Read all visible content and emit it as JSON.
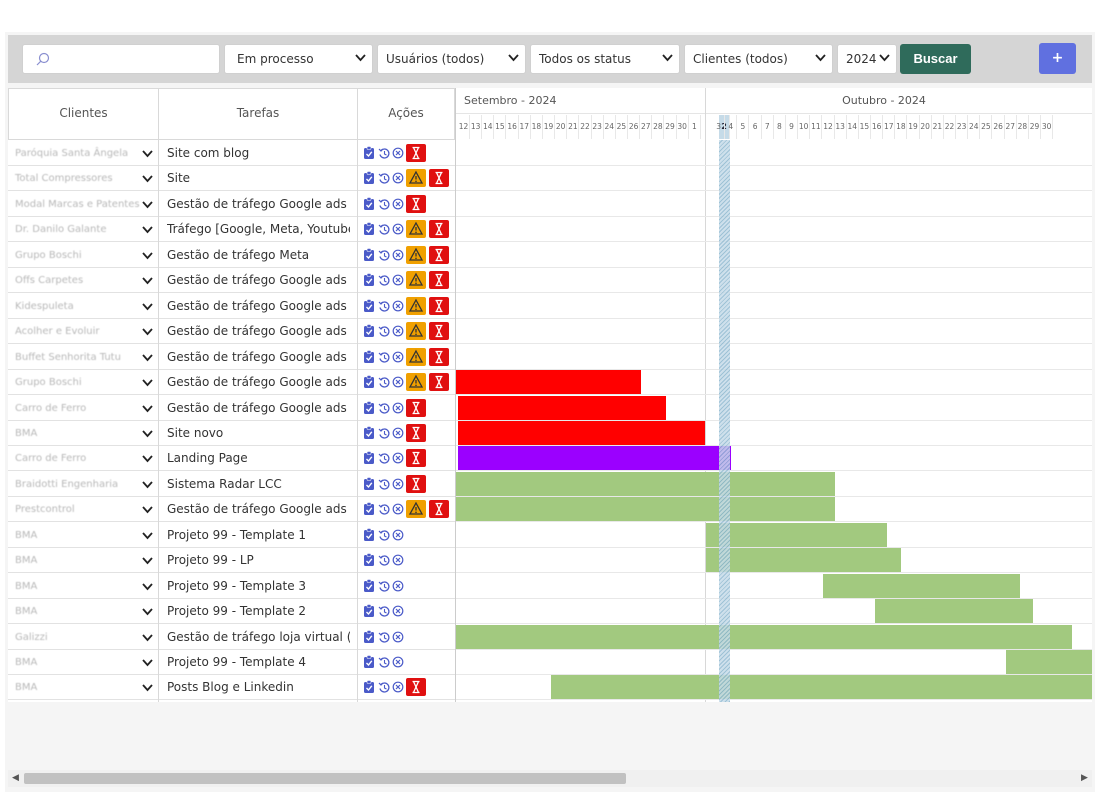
{
  "toolbar": {
    "search_placeholder": "",
    "filters": [
      "Em processo",
      "Usuários (todos)",
      "Todos os status",
      "Clientes (todos)",
      "2024"
    ],
    "buscar_label": "Buscar",
    "add_label": "+"
  },
  "columns": {
    "clientes": "Clientes",
    "tarefas": "Tarefas",
    "acoes": "Ações"
  },
  "gantt": {
    "month_sep": "Setembro - 2024",
    "month_oct": "Outubro - 2024",
    "days_sep": [
      "12",
      "13",
      "14",
      "15",
      "16",
      "17",
      "18",
      "19",
      "20",
      "21",
      "22",
      "23",
      "24",
      "25",
      "26",
      "27",
      "28",
      "29",
      "30"
    ],
    "days_oct": [
      "1",
      "2",
      "3",
      "4",
      "5",
      "6",
      "7",
      "8",
      "9",
      "10",
      "11",
      "12",
      "13",
      "14",
      "15",
      "16",
      "17",
      "18",
      "19",
      "20",
      "21",
      "22",
      "23",
      "24",
      "25",
      "26",
      "27",
      "28",
      "29",
      "30"
    ],
    "today_day": "2"
  },
  "colors": {
    "red": "#ff0000",
    "purple": "#9b00ff",
    "green": "#a2c97f",
    "warn": "#f0a000",
    "hourglass": "#e01010",
    "accent": "#2f6b5b"
  },
  "rows": [
    {
      "client": "Paróquia Santa Ângela",
      "task": "Site com blog",
      "warn": false,
      "hour": true,
      "bar": null
    },
    {
      "client": "Total Compressores",
      "task": "Site",
      "warn": true,
      "hour": true,
      "bar": null
    },
    {
      "client": "Modal Marcas e Patentes",
      "task": "Gestão de tráfego Google ads",
      "warn": false,
      "hour": true,
      "bar": null
    },
    {
      "client": "Dr. Danilo Galante",
      "task": "Tráfego [Google, Meta, Youtube]",
      "warn": true,
      "hour": true,
      "bar": null
    },
    {
      "client": "Grupo Boschi",
      "task": "Gestão de tráfego Meta",
      "warn": true,
      "hour": true,
      "bar": null
    },
    {
      "client": "Offs Carpetes",
      "task": "Gestão de tráfego Google ads",
      "warn": true,
      "hour": true,
      "bar": null
    },
    {
      "client": "Kidespuleta",
      "task": "Gestão de tráfego Google ads",
      "warn": true,
      "hour": true,
      "bar": null
    },
    {
      "client": "Acolher e Evoluir",
      "task": "Gestão de tráfego Google ads",
      "warn": true,
      "hour": true,
      "bar": null
    },
    {
      "client": "Buffet Senhorita Tutu",
      "task": "Gestão de tráfego Google ads",
      "warn": true,
      "hour": true,
      "bar": null
    },
    {
      "client": "Grupo Boschi",
      "task": "Gestão de tráfego Google ads",
      "warn": true,
      "hour": true,
      "bar": {
        "color": "red",
        "start": 0,
        "end": 15.2
      }
    },
    {
      "client": "Carro de Ferro",
      "task": "Gestão de tráfego Google ads",
      "warn": false,
      "hour": true,
      "bar": {
        "color": "red",
        "start": 0.2,
        "end": 17.3
      }
    },
    {
      "client": "BMA",
      "task": "Site novo",
      "warn": false,
      "hour": true,
      "bar": {
        "color": "red",
        "start": 0.2,
        "end": 20.5
      }
    },
    {
      "client": "Carro de Ferro",
      "task": "Landing Page",
      "warn": false,
      "hour": true,
      "bar": {
        "color": "purple",
        "start": 0.2,
        "end": 22.6
      }
    },
    {
      "client": "Braidotti Engenharia",
      "task": "Sistema Radar LCC",
      "warn": false,
      "hour": true,
      "bar": {
        "color": "green",
        "start": 0,
        "end": 31.2
      }
    },
    {
      "client": "Prestcontrol",
      "task": "Gestão de tráfego Google ads",
      "warn": true,
      "hour": true,
      "bar": {
        "color": "green",
        "start": 0,
        "end": 31.2
      }
    },
    {
      "client": "BMA",
      "task": "Projeto 99 - Template 1",
      "warn": false,
      "hour": false,
      "bar": {
        "color": "green",
        "start": 20.6,
        "end": 35.5
      }
    },
    {
      "client": "BMA",
      "task": "Projeto 99 - LP",
      "warn": false,
      "hour": false,
      "bar": {
        "color": "green",
        "start": 20.6,
        "end": 36.6
      }
    },
    {
      "client": "BMA",
      "task": "Projeto 99 - Template 3",
      "warn": false,
      "hour": false,
      "bar": {
        "color": "green",
        "start": 30.2,
        "end": 46.4
      }
    },
    {
      "client": "BMA",
      "task": "Projeto 99 - Template 2",
      "warn": false,
      "hour": false,
      "bar": {
        "color": "green",
        "start": 34.5,
        "end": 47.5
      }
    },
    {
      "client": "Galizzi",
      "task": "Gestão de tráfego loja virtual (Mercado Livre)",
      "warn": false,
      "hour": false,
      "bar": {
        "color": "green",
        "start": 0,
        "end": 50.7
      }
    },
    {
      "client": "BMA",
      "task": "Projeto 99 - Template 4",
      "warn": false,
      "hour": false,
      "bar": {
        "color": "green",
        "start": 45.3,
        "end": 53
      }
    },
    {
      "client": "BMA",
      "task": "Posts Blog e Linkedin",
      "warn": false,
      "hour": true,
      "bar": {
        "color": "green",
        "start": 7.8,
        "end": 53
      }
    }
  ]
}
